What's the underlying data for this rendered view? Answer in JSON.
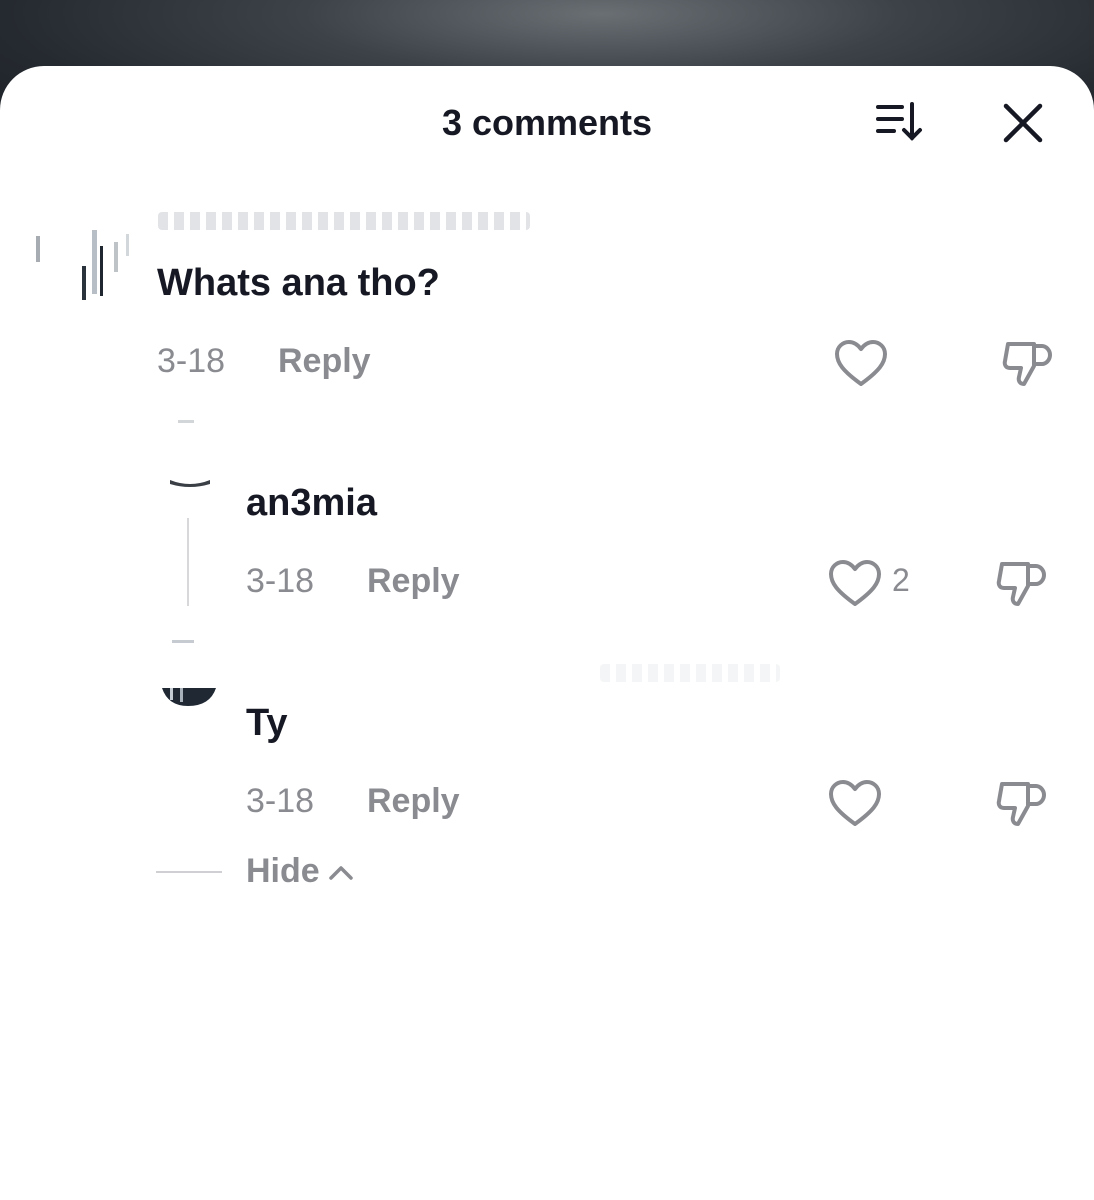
{
  "header": {
    "title": "3 comments",
    "sort_icon": "sort-descending-icon",
    "close_icon": "close-icon"
  },
  "comments": [
    {
      "text": "Whats ana tho?",
      "date": "3-18",
      "reply_label": "Reply",
      "likes": ""
    },
    {
      "text": "an3mia",
      "date": "3-18",
      "reply_label": "Reply",
      "likes": "2"
    },
    {
      "text": "Ty",
      "date": "3-18",
      "reply_label": "Reply",
      "likes": ""
    }
  ],
  "replies_toggle": {
    "label": "Hide"
  },
  "colors": {
    "text_primary": "#161823",
    "text_secondary": "#8a8b91",
    "sheet_background": "#ffffff"
  }
}
